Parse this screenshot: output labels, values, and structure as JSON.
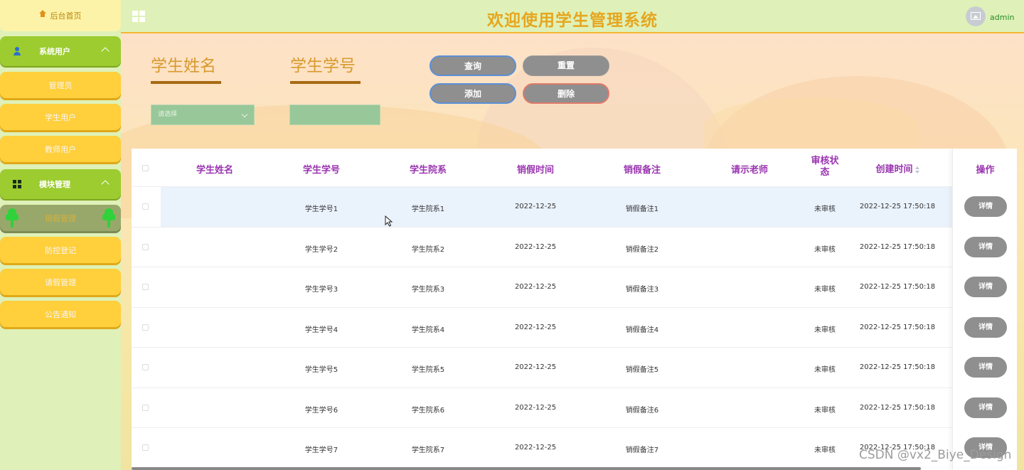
{
  "sidebar": {
    "home": "后台首页",
    "group1": {
      "label": "系统用户",
      "items": [
        "管理员",
        "学生用户",
        "教师用户"
      ]
    },
    "group2": {
      "label": "模块管理",
      "items": [
        "销假管理",
        "防控登记",
        "请假管理",
        "公告通知"
      ]
    }
  },
  "header": {
    "title": "欢迎使用学生管理系统",
    "username": "admin"
  },
  "search": {
    "name_label": "学生姓名",
    "id_label": "学生学号",
    "select_placeholder": "请选择",
    "buttons": {
      "query": "查询",
      "reset": "重置",
      "add": "添加",
      "delete": "删除"
    }
  },
  "table": {
    "columns": [
      "学生姓名",
      "学生学号",
      "学生院系",
      "销假时间",
      "销假备注",
      "请示老师",
      "审核状态",
      "创建时间",
      "操作"
    ],
    "rows": [
      {
        "name": "",
        "id": "学生学号1",
        "dept": "学生院系1",
        "time": "2022-12-25",
        "note": "销假备注1",
        "teacher": "",
        "status": "未审核",
        "created": "2022-12-25 17:50:18",
        "op": "详情"
      },
      {
        "name": "",
        "id": "学生学号2",
        "dept": "学生院系2",
        "time": "2022-12-25",
        "note": "销假备注2",
        "teacher": "",
        "status": "未审核",
        "created": "2022-12-25 17:50:18",
        "op": "详情"
      },
      {
        "name": "",
        "id": "学生学号3",
        "dept": "学生院系3",
        "time": "2022-12-25",
        "note": "销假备注3",
        "teacher": "",
        "status": "未审核",
        "created": "2022-12-25 17:50:18",
        "op": "详情"
      },
      {
        "name": "",
        "id": "学生学号4",
        "dept": "学生院系4",
        "time": "2022-12-25",
        "note": "销假备注4",
        "teacher": "",
        "status": "未审核",
        "created": "2022-12-25 17:50:18",
        "op": "详情"
      },
      {
        "name": "",
        "id": "学生学号5",
        "dept": "学生院系5",
        "time": "2022-12-25",
        "note": "销假备注5",
        "teacher": "",
        "status": "未审核",
        "created": "2022-12-25 17:50:18",
        "op": "详情"
      },
      {
        "name": "",
        "id": "学生学号6",
        "dept": "学生院系6",
        "time": "2022-12-25",
        "note": "销假备注6",
        "teacher": "",
        "status": "未审核",
        "created": "2022-12-25 17:50:18",
        "op": "详情"
      },
      {
        "name": "",
        "id": "学生学号7",
        "dept": "学生院系7",
        "time": "2022-12-25",
        "note": "销假备注7",
        "teacher": "",
        "status": "未审核",
        "created": "2022-12-25 17:50:18",
        "op": "详情"
      }
    ]
  },
  "watermark": "CSDN @vx2_Biye_Design"
}
